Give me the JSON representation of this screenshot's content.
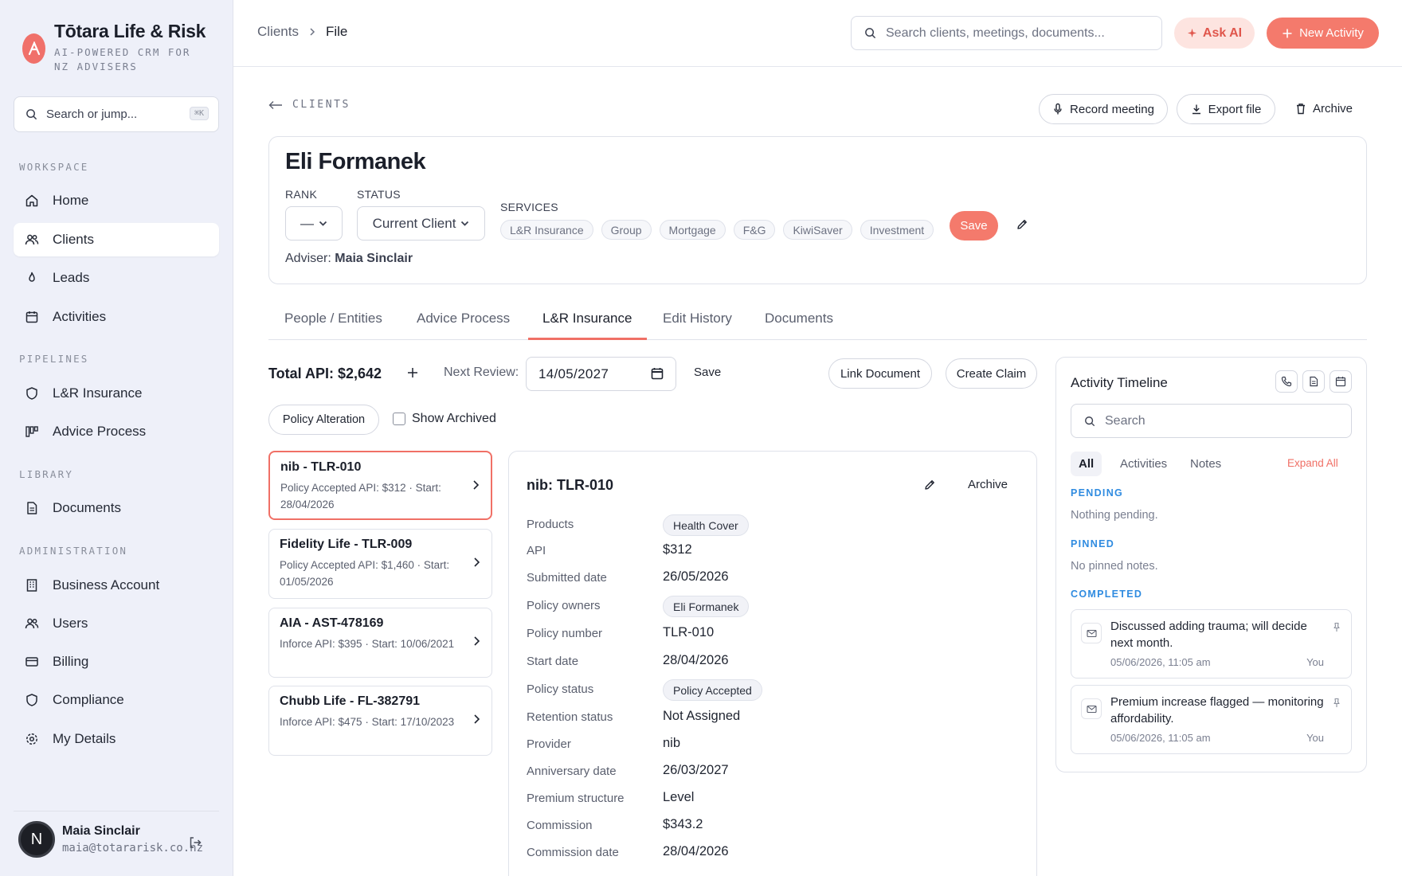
{
  "brand": {
    "title": "Tōtara Life & Risk",
    "subtitle": "AI-POWERED CRM FOR NZ ADVISERS"
  },
  "sidebar": {
    "search_placeholder": "Search or jump...",
    "search_shortcut": "⌘K",
    "sections": {
      "workspace": "WORKSPACE",
      "pipelines": "PIPELINES",
      "library": "LIBRARY",
      "administration": "ADMINISTRATION"
    },
    "items": {
      "home": "Home",
      "clients": "Clients",
      "leads": "Leads",
      "activities": "Activities",
      "lr_insurance": "L&R Insurance",
      "advice_process": "Advice Process",
      "documents": "Documents",
      "business_account": "Business Account",
      "users": "Users",
      "billing": "Billing",
      "compliance": "Compliance",
      "my_details": "My Details"
    },
    "active": "clients"
  },
  "user": {
    "initial": "N",
    "name": "Maia Sinclair",
    "email": "maia@totararisk.co.nz"
  },
  "header": {
    "breadcrumb": [
      "Clients",
      "File"
    ],
    "search_placeholder": "Search clients, meetings, documents...",
    "ask_ai": "Ask AI",
    "new_activity": "New Activity"
  },
  "page": {
    "back_label": "CLIENTS",
    "record_meeting": "Record meeting",
    "export_file": "Export file",
    "archive": "Archive"
  },
  "client": {
    "name": "Eli Formanek",
    "rank_label": "RANK",
    "rank_value": "—",
    "status_label": "STATUS",
    "status_value": "Current Client",
    "services_label": "SERVICES",
    "services": [
      "L&R Insurance",
      "Group",
      "Mortgage",
      "F&G",
      "KiwiSaver",
      "Investment"
    ],
    "save": "Save",
    "adviser_label": "Adviser:",
    "adviser_name": "Maia Sinclair"
  },
  "tabs": [
    "People / Entities",
    "Advice Process",
    "L&R Insurance",
    "Edit History",
    "Documents"
  ],
  "active_tab": "L&R Insurance",
  "toolbar": {
    "total_api": "Total API: $2,642",
    "next_review_label": "Next Review:",
    "next_review_value": "14/05/2027",
    "save": "Save",
    "link_document": "Link Document",
    "create_claim": "Create Claim",
    "policy_alteration": "Policy Alteration",
    "show_archived": "Show Archived"
  },
  "policies": [
    {
      "title": "nib - TLR-010",
      "sub": "Policy Accepted API: $312 · Start: 28/04/2026",
      "selected": true
    },
    {
      "title": "Fidelity Life - TLR-009",
      "sub": "Policy Accepted API: $1,460 · Start: 01/05/2026",
      "selected": false
    },
    {
      "title": "AIA - AST-478169",
      "sub": "Inforce API: $395 · Start: 10/06/2021",
      "selected": false
    },
    {
      "title": "Chubb Life - FL-382791",
      "sub": "Inforce API: $475 · Start: 17/10/2023",
      "selected": false
    }
  ],
  "detail": {
    "title": "nib: TLR-010",
    "archive": "Archive",
    "rows": {
      "products": {
        "label": "Products",
        "value": "Health Cover"
      },
      "api": {
        "label": "API",
        "value": "$312"
      },
      "submitted": {
        "label": "Submitted date",
        "value": "26/05/2026"
      },
      "owners": {
        "label": "Policy owners",
        "value": "Eli Formanek"
      },
      "number": {
        "label": "Policy number",
        "value": "TLR-010"
      },
      "start": {
        "label": "Start date",
        "value": "28/04/2026"
      },
      "status": {
        "label": "Policy status",
        "value": "Policy Accepted"
      },
      "retention": {
        "label": "Retention status",
        "value": "Not Assigned"
      },
      "provider": {
        "label": "Provider",
        "value": "nib"
      },
      "anniversary": {
        "label": "Anniversary date",
        "value": "26/03/2027"
      },
      "premium": {
        "label": "Premium structure",
        "value": "Level"
      },
      "commission": {
        "label": "Commission",
        "value": "$343.2"
      },
      "commission_date": {
        "label": "Commission date",
        "value": "28/04/2026"
      }
    }
  },
  "timeline": {
    "title": "Activity Timeline",
    "search_placeholder": "Search",
    "filters": [
      "All",
      "Activities",
      "Notes"
    ],
    "expand_all": "Expand All",
    "pending_label": "PENDING",
    "pending_empty": "Nothing pending.",
    "pinned_label": "PINNED",
    "pinned_empty": "No pinned notes.",
    "completed_label": "COMPLETED",
    "notes": [
      {
        "text": "Discussed adding trauma; will decide next month.",
        "time": "05/06/2026, 11:05 am",
        "by": "You"
      },
      {
        "text": "Premium increase flagged — monitoring affordability.",
        "time": "05/06/2026, 11:05 am",
        "by": "You"
      }
    ]
  },
  "colors": {
    "accent": "#f07066",
    "accent_soft": "#fde4e0",
    "section_blue": "#2f8be0",
    "sidebar_bg": "#eef0f9"
  }
}
